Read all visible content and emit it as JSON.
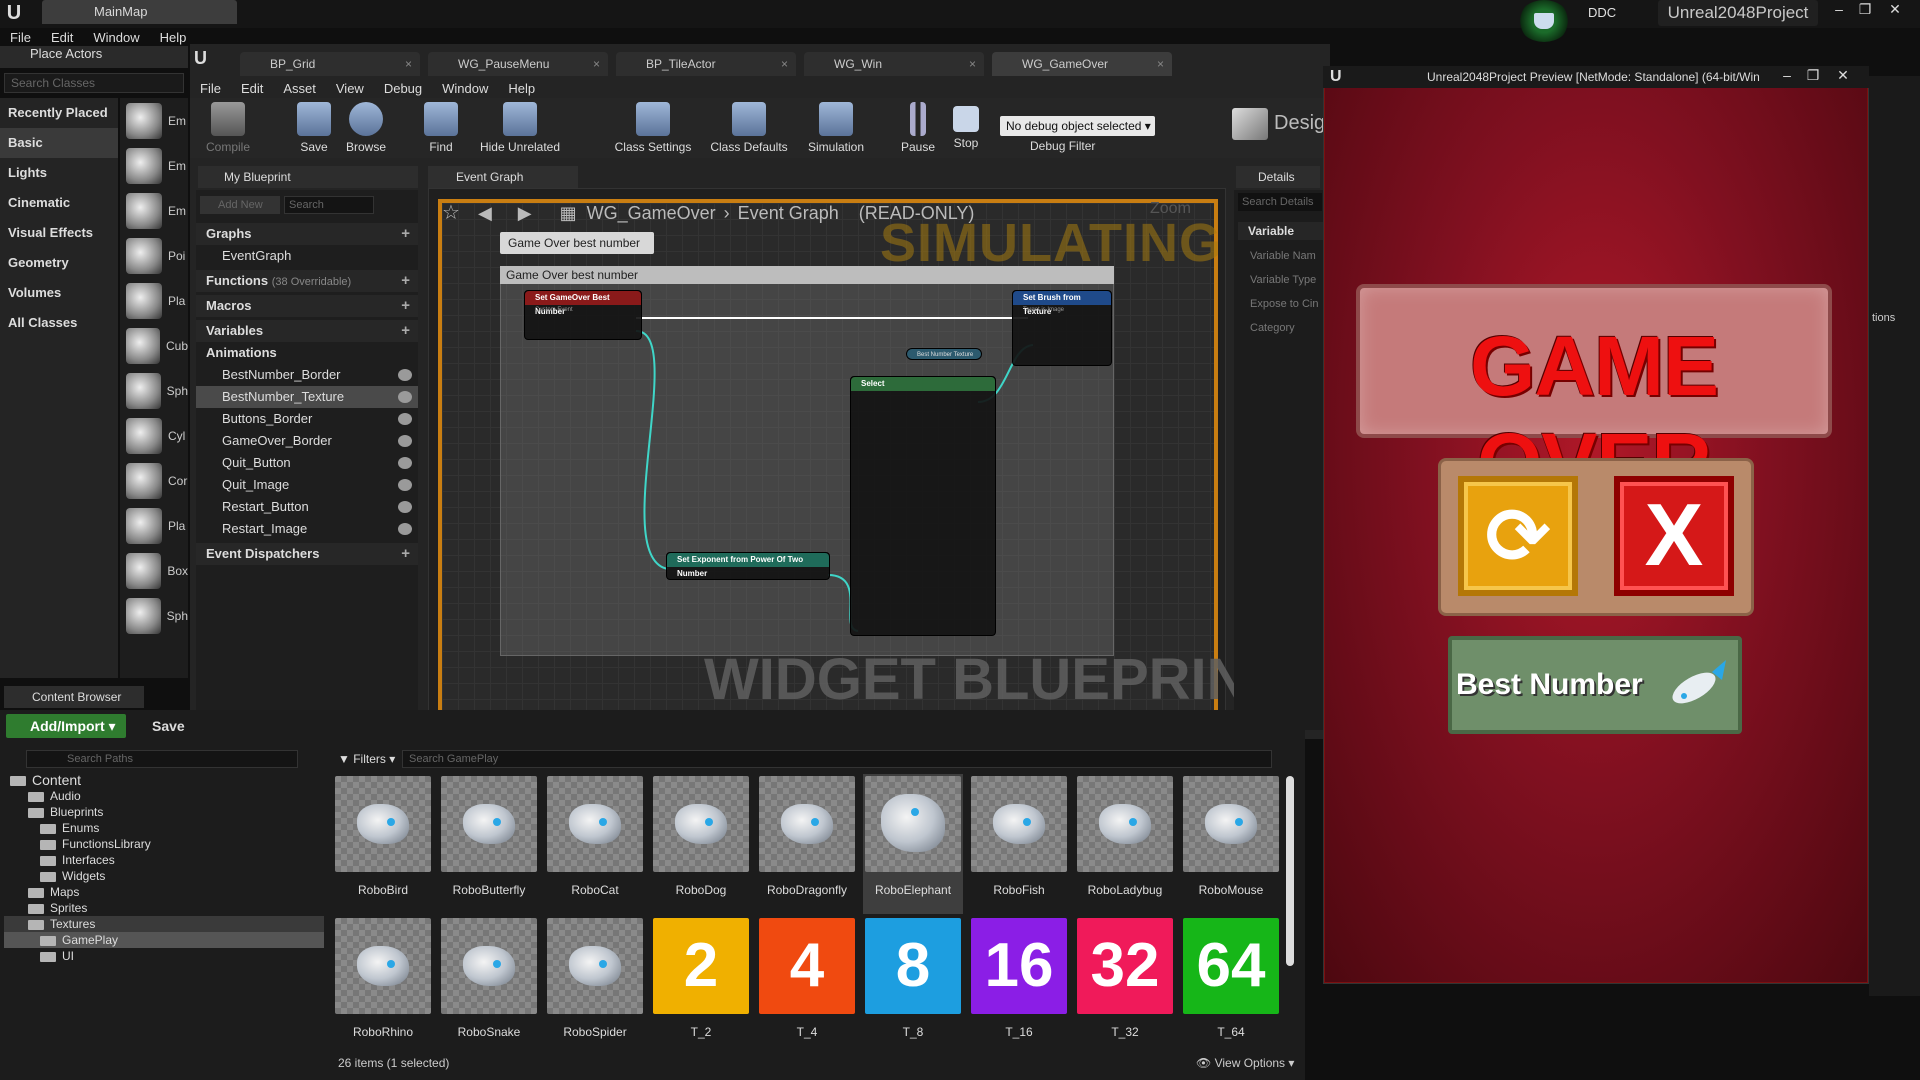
{
  "app": {
    "map_tab": "MainMap",
    "ddc": "DDC",
    "project": "Unreal2048Project",
    "menu": [
      "File",
      "Edit",
      "Window",
      "Help"
    ]
  },
  "place_actors": {
    "tab": "Place Actors",
    "search_placeholder": "Search Classes",
    "categories": [
      "Recently Placed",
      "Basic",
      "Lights",
      "Cinematic",
      "Visual Effects",
      "Geometry",
      "Volumes",
      "All Classes"
    ],
    "selected_category": "Basic",
    "items": [
      "Em",
      "Em",
      "Em",
      "Poi",
      "Pla",
      "Cub",
      "Sph",
      "Cyl",
      "Cor",
      "Pla",
      "Box",
      "Sph"
    ]
  },
  "bp_editor": {
    "tabs": [
      "BP_Grid",
      "WG_PauseMenu",
      "BP_TileActor",
      "WG_Win",
      "WG_GameOver"
    ],
    "active_tab": "WG_GameOver",
    "menu": [
      "File",
      "Edit",
      "Asset",
      "View",
      "Debug",
      "Window",
      "Help"
    ],
    "toolbar": {
      "compile": "Compile",
      "save": "Save",
      "browse": "Browse",
      "find": "Find",
      "hide_unrelated": "Hide Unrelated",
      "class_settings": "Class Settings",
      "class_defaults": "Class Defaults",
      "simulation": "Simulation",
      "pause": "Pause",
      "stop": "Stop",
      "debug_select": "No debug object selected",
      "debug_filter": "Debug Filter",
      "designer": "Desig"
    },
    "my_blueprint": {
      "tab": "My Blueprint",
      "add_new": "Add New",
      "search_placeholder": "Search",
      "graphs_label": "Graphs",
      "event_graph": "EventGraph",
      "functions_label": "Functions",
      "functions_note": "(38 Overridable)",
      "macros_label": "Macros",
      "variables_label": "Variables",
      "animations_label": "Animations",
      "variables": [
        "BestNumber_Border",
        "BestNumber_Texture",
        "Buttons_Border",
        "GameOver_Border",
        "Quit_Button",
        "Quit_Image",
        "Restart_Button",
        "Restart_Image"
      ],
      "selected_variable": "BestNumber_Texture",
      "event_dispatchers": "Event Dispatchers"
    },
    "graph": {
      "tab": "Event Graph",
      "crumb_root": "WG_GameOver",
      "crumb_graph": "Event Graph",
      "readonly": "(READ-ONLY)",
      "zoom": "Zoom",
      "simulating": "SIMULATING",
      "watermark": "WIDGET BLUEPRINT",
      "comment_bubble": "Game Over best number",
      "comment_title": "Game Over best number",
      "nodes": {
        "event": "Set GameOver Best Number",
        "event_sub": "Custom Event",
        "brush": "Set Brush from Texture",
        "brush_sub": "Target is Image",
        "texture_var": "Best Number Texture",
        "select": "Select",
        "exponent": "Set Exponent from Power Of Two Number"
      }
    },
    "details": {
      "tab": "Details",
      "search_placeholder": "Search Details",
      "section": "Variable",
      "rows": [
        "Variable Nam",
        "Variable Type",
        "Expose to Cin",
        "Category"
      ]
    }
  },
  "preview": {
    "title": "Unreal2048Project Preview [NetMode: Standalone]  (64-bit/Win",
    "game_over": "GAME OVER",
    "restart_glyph": "⟳",
    "quit_glyph": "X",
    "best_number": "Best Number",
    "options": "tions"
  },
  "content_browser": {
    "tab": "Content Browser",
    "add_import": "Add/Import",
    "save": "Save",
    "paths_placeholder": "Search Paths",
    "filters": "Filters",
    "search_placeholder": "Search GamePlay",
    "tree": [
      {
        "label": "Content",
        "depth": 0
      },
      {
        "label": "Audio",
        "depth": 1
      },
      {
        "label": "Blueprints",
        "depth": 1
      },
      {
        "label": "Enums",
        "depth": 2
      },
      {
        "label": "FunctionsLibrary",
        "depth": 2
      },
      {
        "label": "Interfaces",
        "depth": 2
      },
      {
        "label": "Widgets",
        "depth": 2
      },
      {
        "label": "Maps",
        "depth": 1
      },
      {
        "label": "Sprites",
        "depth": 1
      },
      {
        "label": "Textures",
        "depth": 1
      },
      {
        "label": "GamePlay",
        "depth": 2
      },
      {
        "label": "UI",
        "depth": 2
      }
    ],
    "selected_folder": "GamePlay",
    "assets_row1": [
      "RoboBird",
      "RoboButterfly",
      "RoboCat",
      "RoboDog",
      "RoboDragonfly",
      "RoboElephant",
      "RoboFish",
      "RoboLadybug",
      "RoboMouse"
    ],
    "assets_row2": [
      "RoboRhino",
      "RoboSnake",
      "RoboSpider"
    ],
    "number_tiles": [
      {
        "value": "2",
        "label": "T_2",
        "color": "#f0b000"
      },
      {
        "value": "4",
        "label": "T_4",
        "color": "#f04a10"
      },
      {
        "value": "8",
        "label": "T_8",
        "color": "#1d9ee0"
      },
      {
        "value": "16",
        "label": "T_16",
        "color": "#8b1ee6"
      },
      {
        "value": "32",
        "label": "T_32",
        "color": "#f01a5a"
      },
      {
        "value": "64",
        "label": "T_64",
        "color": "#16b618"
      }
    ],
    "selected_asset": "RoboElephant",
    "status": "26 items (1 selected)",
    "view_options": "View Options"
  }
}
